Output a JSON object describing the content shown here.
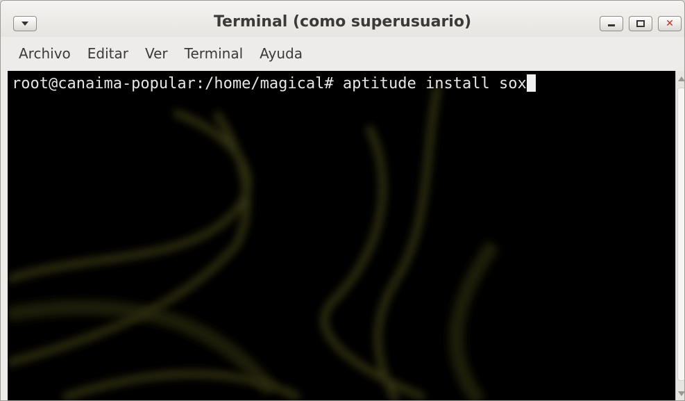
{
  "window": {
    "title": "Terminal (como superusuario)",
    "menu_icon": "dropdown-arrow-icon",
    "controls": {
      "minimize": "minimize-icon",
      "maximize": "maximize-icon",
      "close": "✕"
    }
  },
  "menubar": {
    "items": [
      "Archivo",
      "Editar",
      "Ver",
      "Terminal",
      "Ayuda"
    ]
  },
  "terminal": {
    "prompt": "root@canaima-popular:/home/magical# ",
    "command": "aptitude install sox",
    "background_color": "#000000",
    "text_color": "#e6e6e6"
  },
  "colors": {
    "window_bg": "#edeceb",
    "close_accent": "#cc2a1e"
  }
}
